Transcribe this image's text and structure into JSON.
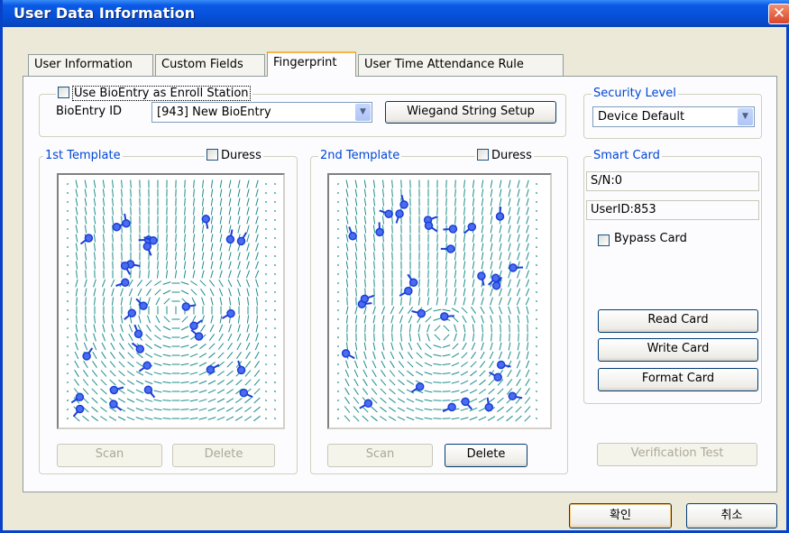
{
  "window": {
    "title": "User Data Information",
    "close_glyph": "✕"
  },
  "tabs": [
    {
      "label": "User Information"
    },
    {
      "label": "Custom Fields"
    },
    {
      "label": "Fingerprint"
    },
    {
      "label": "User Time Attendance Rule"
    }
  ],
  "active_tab": "Fingerprint",
  "enroll": {
    "checkbox_label": "Use BioEntry as Enroll Station",
    "checked": false,
    "bioentry_id_label": "BioEntry ID",
    "bioentry_id_value": "[943] New BioEntry",
    "wiegand_button": "Wiegand String Setup"
  },
  "security_level": {
    "legend": "Security Level",
    "value": "Device Default"
  },
  "template1": {
    "legend": "1st Template",
    "duress_label": "Duress",
    "duress_checked": false,
    "scan_button": "Scan",
    "delete_button": "Delete",
    "scan_enabled": false,
    "delete_enabled": false
  },
  "template2": {
    "legend": "2nd Template",
    "duress_label": "Duress",
    "duress_checked": false,
    "scan_button": "Scan",
    "delete_button": "Delete",
    "scan_enabled": false,
    "delete_enabled": true
  },
  "smart_card": {
    "legend": "Smart Card",
    "serial": "S/N:0",
    "user_id": "UserID:853",
    "bypass_label": "Bypass Card",
    "bypass_checked": false,
    "read_button": "Read Card",
    "write_button": "Write Card",
    "format_button": "Format Card"
  },
  "verification_button": "Verification Test",
  "footer": {
    "ok_button": "확인",
    "cancel_button": "취소"
  },
  "colors": {
    "ridge": "#1d8c8c",
    "minutia": "#1a3fd6",
    "legend_text": "#0046d5",
    "titlebar": "#0650d9"
  }
}
